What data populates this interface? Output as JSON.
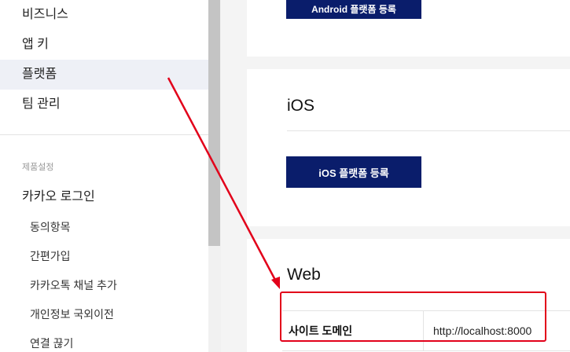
{
  "sidebar": {
    "items": [
      {
        "label": "비즈니스"
      },
      {
        "label": "앱 키"
      },
      {
        "label": "플랫폼"
      },
      {
        "label": "팀 관리"
      }
    ],
    "section_label": "제품설정",
    "kakao_login": "카카오 로그인",
    "sub_items": [
      {
        "label": "동의항목"
      },
      {
        "label": "간편가입"
      },
      {
        "label": "카카오톡 채널 추가"
      },
      {
        "label": "개인정보 국외이전"
      },
      {
        "label": "연결 끊기"
      }
    ]
  },
  "android": {
    "button_label": "Android 플랫폼 등록"
  },
  "ios": {
    "title": "iOS",
    "button_label": "iOS 플랫폼 등록"
  },
  "web": {
    "title": "Web",
    "field_label": "사이트 도메인",
    "field_value": "http://localhost:8000"
  },
  "colors": {
    "accent": "#0a1d6b",
    "highlight": "#e2001a",
    "active_bg": "#eef0f6"
  }
}
